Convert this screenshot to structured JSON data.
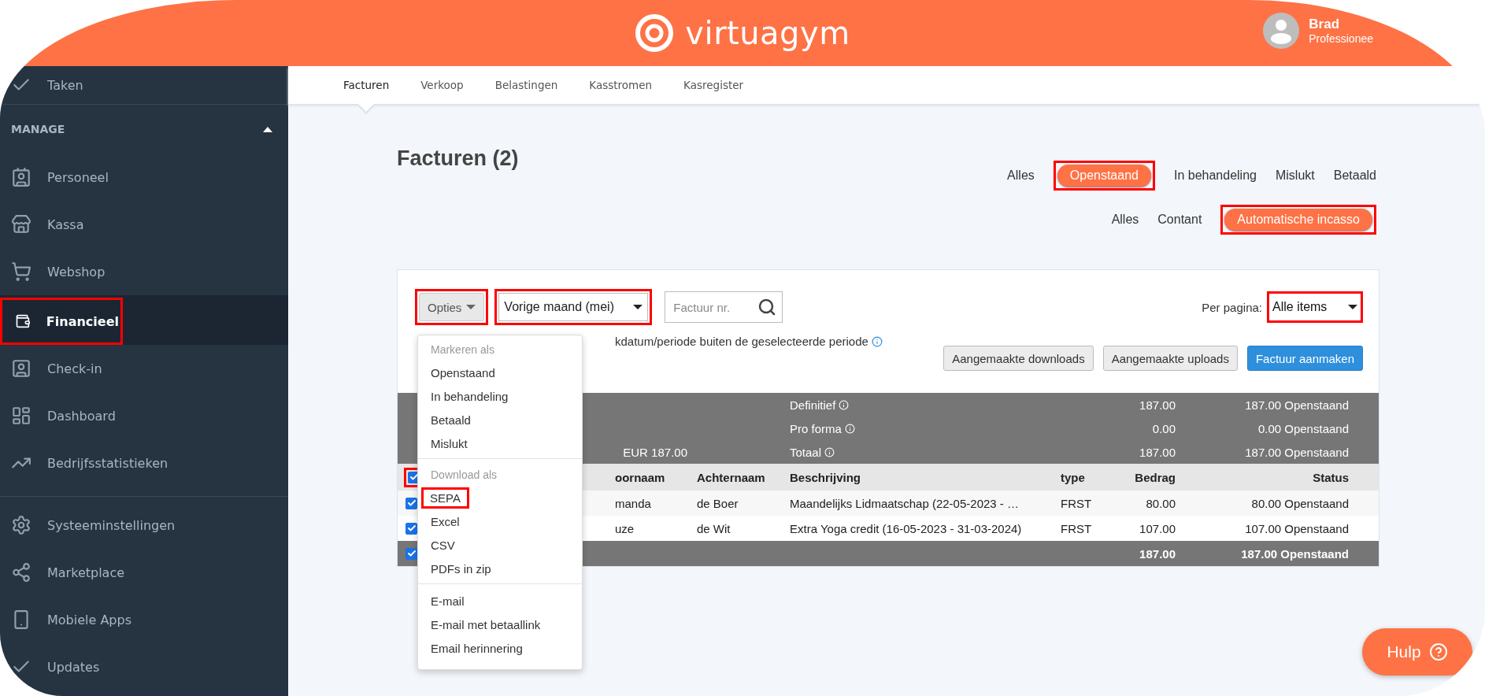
{
  "header": {
    "logo": "virtuagym",
    "user": {
      "name": "Brad",
      "role": "Professionee"
    }
  },
  "sidebar": {
    "top_items": [
      {
        "label": "Taken",
        "selected": false,
        "highlighted": false
      }
    ],
    "section": {
      "title": "MANAGE",
      "expanded": true,
      "items": [
        {
          "label": "Personeel",
          "selected": false,
          "highlighted": false
        },
        {
          "label": "Kassa",
          "selected": false,
          "highlighted": false
        },
        {
          "label": "Webshop",
          "selected": false,
          "highlighted": false
        },
        {
          "label": "Financieel",
          "selected": true,
          "highlighted": true
        },
        {
          "label": "Check-in",
          "selected": false,
          "highlighted": false
        },
        {
          "label": "Dashboard",
          "selected": false,
          "highlighted": false
        },
        {
          "label": "Bedrijfsstatistieken",
          "selected": false,
          "highlighted": false
        }
      ]
    },
    "bottom_items": [
      {
        "label": "Systeeminstellingen",
        "selected": false,
        "highlighted": false
      },
      {
        "label": "Marketplace",
        "selected": false,
        "highlighted": false
      },
      {
        "label": "Mobiele Apps",
        "selected": false,
        "highlighted": false
      },
      {
        "label": "Updates",
        "selected": false,
        "highlighted": false
      }
    ]
  },
  "tabs": [
    {
      "label": "Facturen",
      "selected": true
    },
    {
      "label": "Verkoop",
      "selected": false
    },
    {
      "label": "Belastingen",
      "selected": false
    },
    {
      "label": "Kasstromen",
      "selected": false
    },
    {
      "label": "Kasregister",
      "selected": false
    }
  ],
  "page_title": "Facturen (2)",
  "status_filters": [
    {
      "label": "Alles",
      "selected": false,
      "highlighted": false
    },
    {
      "label": "Openstaand",
      "selected": true,
      "highlighted": true
    },
    {
      "label": "In behandeling",
      "selected": false,
      "highlighted": false
    },
    {
      "label": "Mislukt",
      "selected": false,
      "highlighted": false
    },
    {
      "label": "Betaald",
      "selected": false,
      "highlighted": false
    }
  ],
  "type_filters": [
    {
      "label": "Alles",
      "selected": false,
      "highlighted": false
    },
    {
      "label": "Contant",
      "selected": false,
      "highlighted": false
    },
    {
      "label": "Automatische incasso",
      "selected": true,
      "highlighted": true
    }
  ],
  "toolbar": {
    "options_button": {
      "label": "Opties",
      "highlighted": true
    },
    "period_select": {
      "value": "Vorige maand (mei)",
      "highlighted": true
    },
    "search": {
      "placeholder": "Factuur nr."
    },
    "per_page": {
      "label": "Per pagina:",
      "value": "Alle items",
      "highlighted": true
    },
    "note": "kdatum/periode buiten de geselecteerde periode",
    "buttons": [
      {
        "label": "Aangemaakte downloads",
        "kind": "default"
      },
      {
        "label": "Aangemaakte uploads",
        "kind": "default"
      },
      {
        "label": "Factuur aanmaken",
        "kind": "primary"
      }
    ]
  },
  "summary_rows": [
    {
      "total_text": "",
      "label": "Definitief",
      "amount": "187.00",
      "status": "187.00 Openstaand"
    },
    {
      "total_text": "",
      "label": "Pro forma",
      "amount": "0.00",
      "status": "0.00 Openstaand"
    },
    {
      "total_text": "EUR 187.00",
      "label": "Totaal",
      "amount": "187.00",
      "status": "187.00 Openstaand"
    }
  ],
  "table": {
    "select_all": {
      "checked": true,
      "highlighted": true
    },
    "columns": [
      "oornaam",
      "Achternaam",
      "Beschrijving",
      "type",
      "Bedrag",
      "Status"
    ],
    "rows": [
      {
        "checked": true,
        "cells": [
          "manda",
          "de Boer",
          "Maandelijks Lidmaatschap (22-05-2023 - …",
          "FRST",
          "80.00",
          "80.00 Openstaand"
        ]
      },
      {
        "checked": true,
        "cells": [
          "uze",
          "de Wit",
          "Extra Yoga credit (16-05-2023 - 31-03-2024)",
          "FRST",
          "107.00",
          "107.00 Openstaand"
        ]
      }
    ],
    "footer": {
      "checked": true,
      "amount": "187.00",
      "status": "187.00 Openstaand"
    }
  },
  "options_menu": {
    "sections": [
      {
        "header": "Markeren als",
        "items": [
          {
            "label": "Openstaand",
            "highlighted": false
          },
          {
            "label": "In behandeling",
            "highlighted": false
          },
          {
            "label": "Betaald",
            "highlighted": false
          },
          {
            "label": "Mislukt",
            "highlighted": false
          }
        ]
      },
      {
        "header": "Download als",
        "items": [
          {
            "label": "SEPA",
            "highlighted": true
          },
          {
            "label": "Excel",
            "highlighted": false
          },
          {
            "label": "CSV",
            "highlighted": false
          },
          {
            "label": "PDFs in zip",
            "highlighted": false
          }
        ]
      },
      {
        "items": [
          {
            "label": "E-mail",
            "highlighted": false
          },
          {
            "label": "E-mail met betaallink",
            "highlighted": false
          },
          {
            "label": "Email herinnering",
            "highlighted": false
          }
        ]
      }
    ]
  },
  "help_button": {
    "label": "Hulp"
  }
}
